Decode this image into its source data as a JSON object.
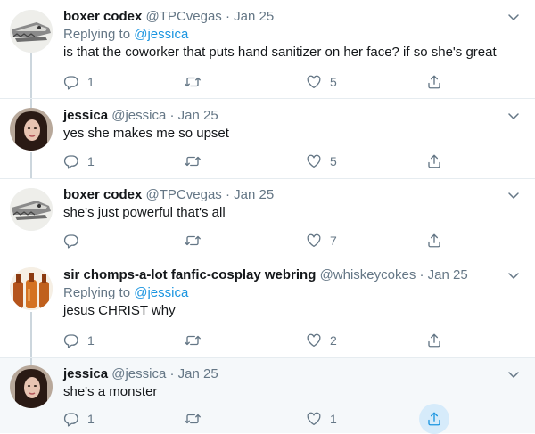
{
  "tweets": [
    {
      "name": "boxer codex",
      "handle": "@TPCvegas",
      "date": "Jan 25",
      "replying_label": "Replying to",
      "replying_to": "@jessica",
      "text": "is that the coworker that puts hand sanitizer on her face? if so she's great",
      "replies": "1",
      "retweets": "",
      "likes": "5",
      "avatar_icon": "crocodile-skull-avatar"
    },
    {
      "name": "jessica",
      "handle": "@jessica",
      "date": "Jan 25",
      "replying_label": "",
      "replying_to": "",
      "text": "yes she makes me so upset",
      "replies": "1",
      "retweets": "",
      "likes": "5",
      "avatar_icon": "woman-portrait-avatar"
    },
    {
      "name": "boxer codex",
      "handle": "@TPCvegas",
      "date": "Jan 25",
      "replying_label": "",
      "replying_to": "",
      "text": "she's just powerful that's all",
      "replies": "",
      "retweets": "",
      "likes": "7",
      "avatar_icon": "crocodile-skull-avatar"
    },
    {
      "name": "sir chomps-a-lot fanfic-cosplay webring",
      "handle": "@whiskeycokes",
      "date": "Jan 25",
      "replying_label": "Replying to",
      "replying_to": "@jessica",
      "text": "jesus CHRIST why",
      "replies": "1",
      "retweets": "",
      "likes": "2",
      "avatar_icon": "bottles-avatar"
    },
    {
      "name": "jessica",
      "handle": "@jessica",
      "date": "Jan 25",
      "replying_label": "",
      "replying_to": "",
      "text": "she's a monster",
      "replies": "1",
      "retweets": "",
      "likes": "1",
      "avatar_icon": "woman-portrait-avatar"
    }
  ],
  "separator": "·",
  "colors": {
    "link": "#1b95e0",
    "muted": "#657786",
    "text": "#14171a",
    "thread_line": "#ccd6dd",
    "border": "#e6ecf0",
    "highlight_bg": "#f5f8fa",
    "share_active_bg": "#d6ebfa"
  }
}
